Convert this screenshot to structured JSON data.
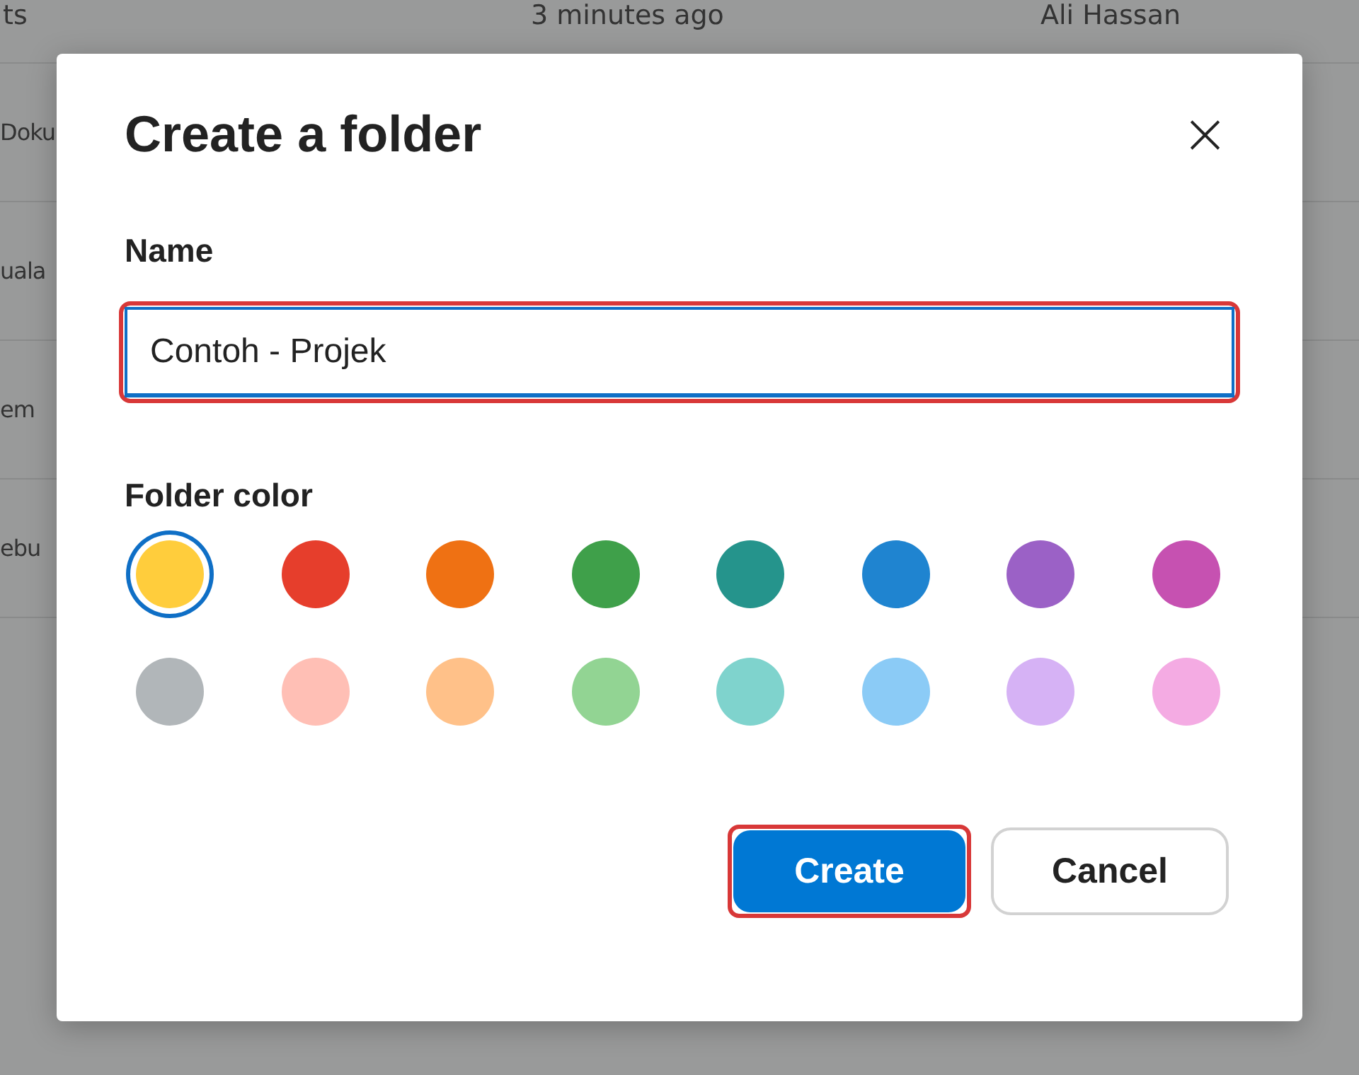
{
  "background_list": {
    "header": [
      "ts",
      "3 minutes ago",
      "Ali Hassan"
    ],
    "rows": [
      "Doku",
      "uala",
      "em",
      "ebu"
    ]
  },
  "dialog": {
    "title": "Create a folder",
    "close": "×",
    "name_field": {
      "label": "Name",
      "value": "Contoh - Projek",
      "highlighted": true
    },
    "color_label": "Folder color",
    "colors": [
      {
        "color": "#ffcd3c",
        "selected": true
      },
      {
        "color": "#e63e2c",
        "selected": false
      },
      {
        "color": "#ef7113",
        "selected": false
      },
      {
        "color": "#3fa04a",
        "selected": false
      },
      {
        "color": "#25948c",
        "selected": false
      },
      {
        "color": "#1f84d0",
        "selected": false
      },
      {
        "color": "#9b61c6",
        "selected": false
      },
      {
        "color": "#c651b1",
        "selected": false
      },
      {
        "color": "#b1b6b9",
        "selected": false
      },
      {
        "color": "#ffbfb5",
        "selected": false
      },
      {
        "color": "#ffc189",
        "selected": false
      },
      {
        "color": "#92d493",
        "selected": false
      },
      {
        "color": "#7fd3cd",
        "selected": false
      },
      {
        "color": "#8bcbf6",
        "selected": false
      },
      {
        "color": "#d6b2f5",
        "selected": false
      },
      {
        "color": "#f4abe3",
        "selected": false
      }
    ],
    "buttons": [
      {
        "label": "Create",
        "kind": "primary",
        "highlighted": true
      },
      {
        "label": "Cancel",
        "kind": "secondary",
        "highlighted": false
      }
    ]
  }
}
